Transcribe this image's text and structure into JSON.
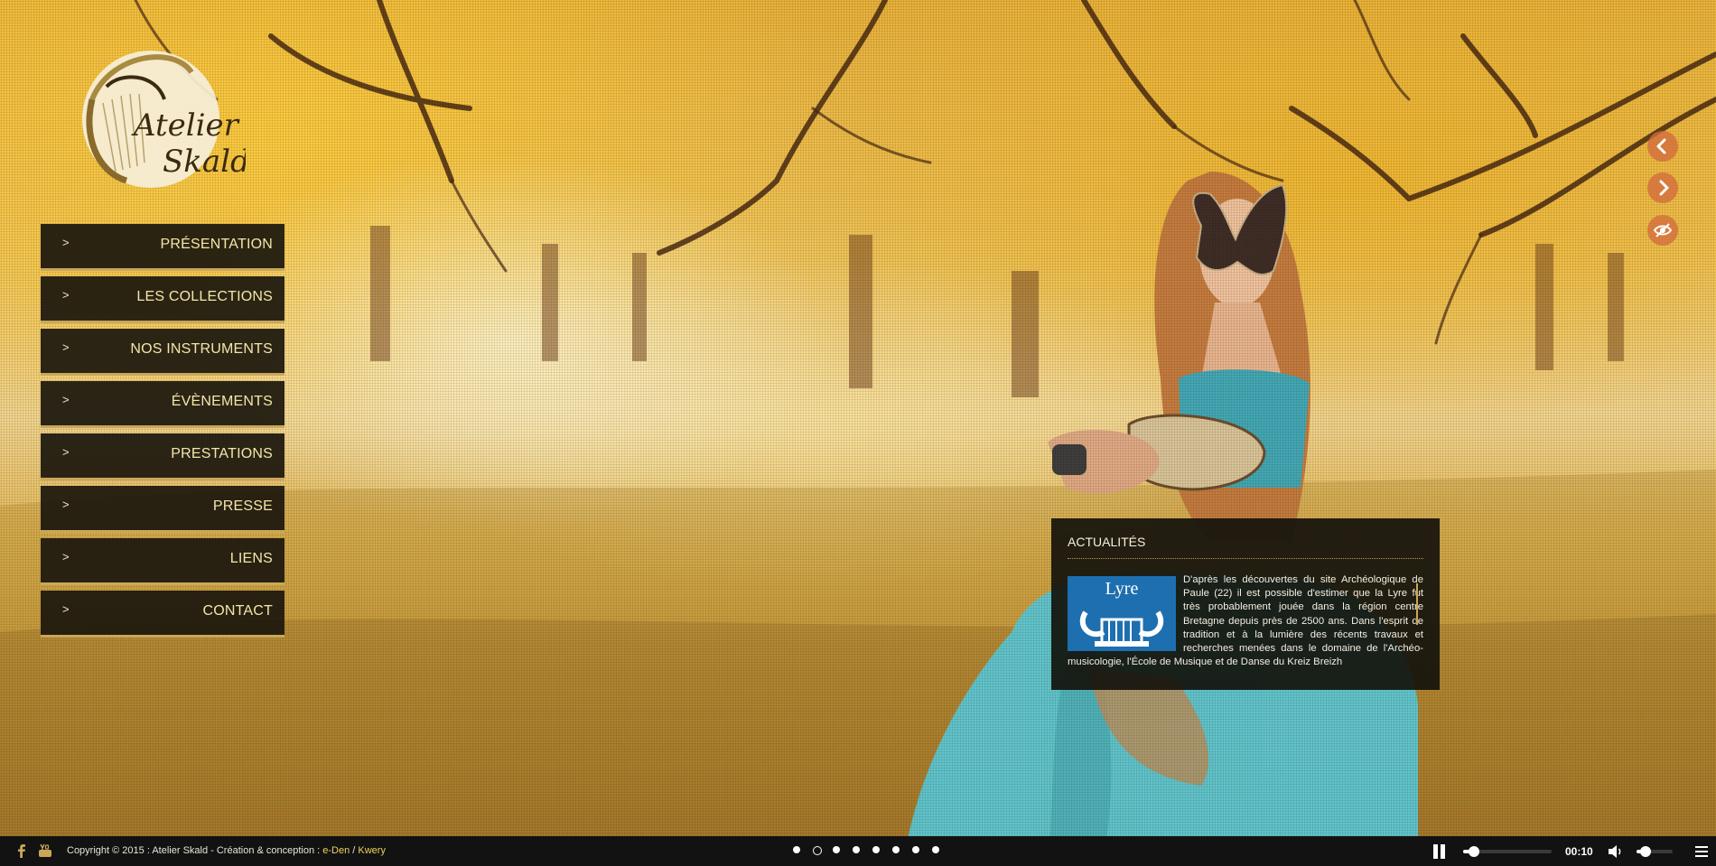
{
  "logo": {
    "line1": "Atelier",
    "line2": "Skald"
  },
  "nav": {
    "arrow_glyph": ">",
    "items": [
      {
        "label": "PRÉSENTATION"
      },
      {
        "label": "LES COLLECTIONS"
      },
      {
        "label": "NOS INSTRUMENTS"
      },
      {
        "label": "ÉVÈNEMENTS"
      },
      {
        "label": "PRESTATIONS"
      },
      {
        "label": "PRESSE"
      },
      {
        "label": "LIENS"
      },
      {
        "label": "CONTACT"
      }
    ]
  },
  "slider_controls": {
    "prev_icon": "chevron-left-icon",
    "next_icon": "chevron-right-icon",
    "hide_icon": "eye-slash-icon"
  },
  "news": {
    "title": "ACTUALITÉS",
    "thumb_title": "Lyre",
    "body": "D'après les découvertes du site Archéologique de Paule (22) il est possible d'estimer que la Lyre fut très probablement jouée dans la région centre Bretagne depuis près de 2500 ans. Dans l'esprit de tradition et à la lumière des récents travaux et recherches menées dans le domaine de l'Archéo-musicologie, l'École de Musique et de Danse du Kreiz Breizh"
  },
  "footer": {
    "social": [
      "facebook-icon",
      "youtube-icon"
    ],
    "copyright_text": "Copyright © 2015 : Atelier Skald - Création & conception : ",
    "credit_1": "e-Den",
    "credit_sep": " / ",
    "credit_2": "Kwery",
    "slides_count": 8,
    "active_slide": 2,
    "progress": 0.1,
    "time": "00:10",
    "volume": 0.2
  },
  "colors": {
    "nav_bg": "#1c180e",
    "nav_text": "#f3e6a8",
    "accent_gold": "#c9a75a",
    "control_orange": "#d46c3e",
    "credit_link": "#f0d35a"
  }
}
